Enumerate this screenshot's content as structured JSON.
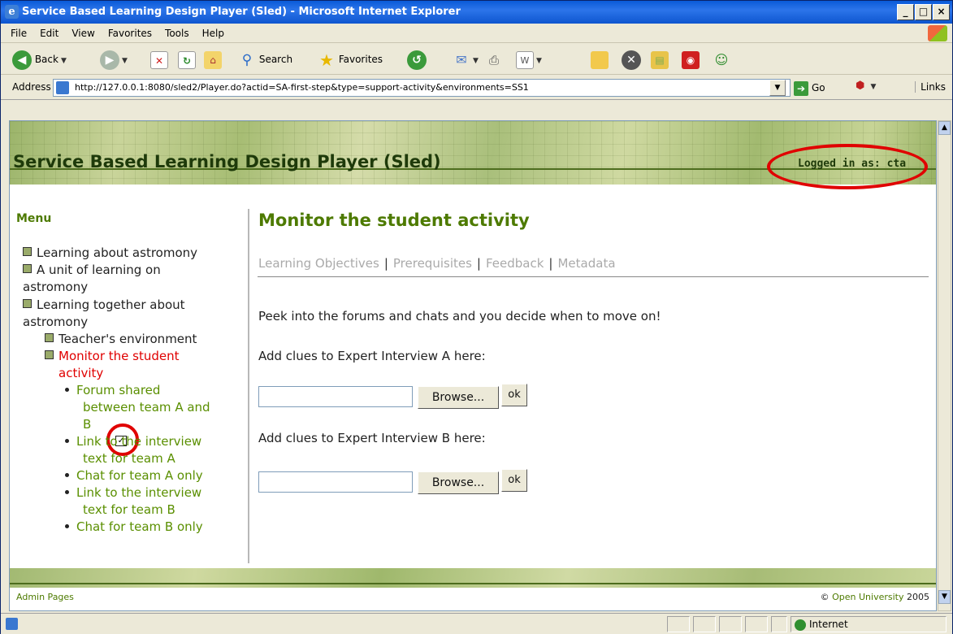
{
  "window": {
    "title": "Service Based Learning Design Player (Sled) - Microsoft Internet Explorer"
  },
  "menubar": [
    "File",
    "Edit",
    "View",
    "Favorites",
    "Tools",
    "Help"
  ],
  "toolbar": {
    "back": "Back",
    "search": "Search",
    "favorites": "Favorites"
  },
  "address": {
    "label": "Address",
    "url": "http://127.0.0.1:8080/sled2/Player.do?actid=SA-first-step&type=support-activity&environments=SS1",
    "go": "Go",
    "links": "Links"
  },
  "page": {
    "banner_title": "Service Based Learning Design Player (Sled)",
    "login": "Logged in as: cta",
    "menu_heading": "Menu",
    "menu": {
      "item1": "Learning about astromony",
      "item2a": "A unit of learning on",
      "item2b": "astromony",
      "item3a": "Learning together about",
      "item3b": "astromony",
      "item4": "Teacher's environment",
      "item5a": "Monitor the student",
      "item5b": "activity",
      "sub1a": "Forum shared",
      "sub1b": "between team A and",
      "sub1c": "B",
      "sub2a": "Link to the interview",
      "sub2b": "text for team A",
      "sub3": "Chat for team A only",
      "sub4a": "Link to the interview",
      "sub4b": "text for team B",
      "sub5": "Chat for team B only"
    },
    "main": {
      "heading": "Monitor the student activity",
      "tabs": [
        "Learning Objectives",
        "Prerequisites",
        "Feedback",
        "Metadata"
      ],
      "intro": "Peek into the forums and chats and you decide when to move on!",
      "clue_a": "Add clues to Expert Interview A here:",
      "clue_b": "Add clues to Expert Interview B here:",
      "browse": "Browse...",
      "ok": "ok"
    },
    "footer": {
      "admin": "Admin Pages",
      "copy_prefix": "©",
      "org": "Open University",
      "year": "2005"
    }
  },
  "status": {
    "zone": "Internet"
  }
}
